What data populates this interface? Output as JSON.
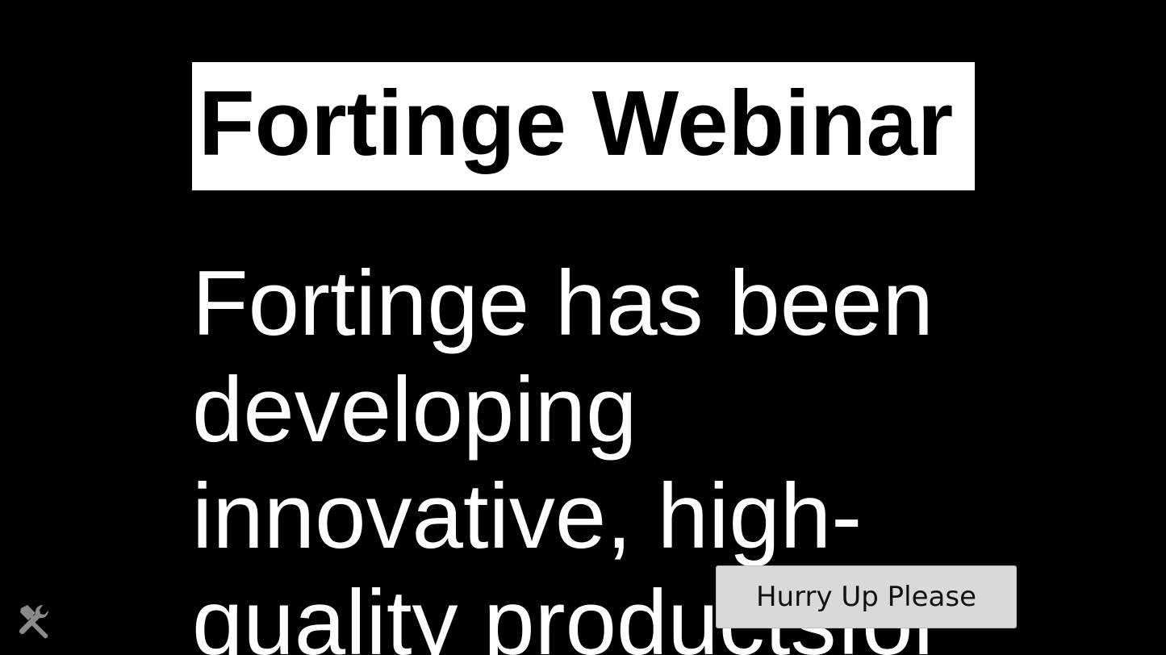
{
  "slide": {
    "title": "Fortinge Webinar",
    "body": "Fortinge has been\ndeveloping\ninnovative, high-\nquality productsfor"
  },
  "overlay": {
    "button_label": "Hurry Up Please"
  },
  "toolbar": {
    "icon": "tools-icon"
  },
  "colors": {
    "background": "#000000",
    "title_box": "#ffffff",
    "title_text": "#000000",
    "body_text": "#ffffff",
    "button_bg": "#d9d9d9",
    "icon": "#8a8a8a"
  }
}
